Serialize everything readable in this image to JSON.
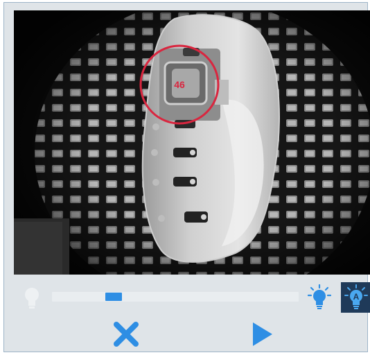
{
  "viewport": {
    "marker_label": "46",
    "marker_color": "#d9263f"
  },
  "controls": {
    "light_level_percent": 25,
    "accent_color": "#2e8ee4",
    "icons": {
      "light_off": "lightbulb-off-icon",
      "light_on": "lightbulb-on-icon",
      "auto_light": "auto-light-icon",
      "cancel": "close-icon",
      "play": "play-icon"
    },
    "auto_light_letter": "A"
  }
}
